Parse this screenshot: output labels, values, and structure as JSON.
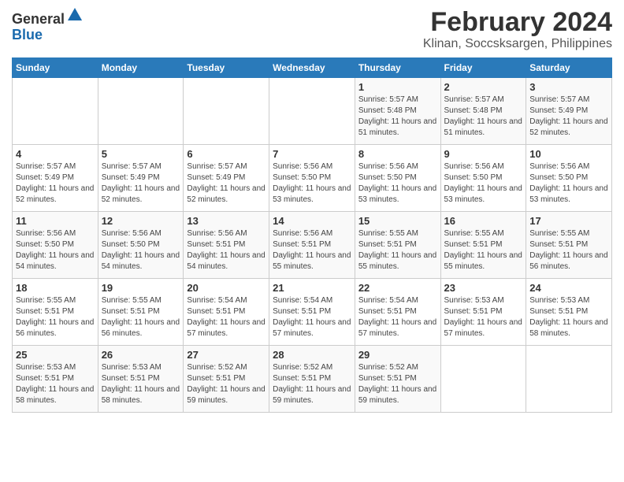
{
  "header": {
    "logo_general": "General",
    "logo_blue": "Blue",
    "month_title": "February 2024",
    "location": "Klinan, Soccsksargen, Philippines"
  },
  "days_of_week": [
    "Sunday",
    "Monday",
    "Tuesday",
    "Wednesday",
    "Thursday",
    "Friday",
    "Saturday"
  ],
  "weeks": [
    [
      {
        "day": "",
        "sunrise": "",
        "sunset": "",
        "daylight": "",
        "empty": true
      },
      {
        "day": "",
        "sunrise": "",
        "sunset": "",
        "daylight": "",
        "empty": true
      },
      {
        "day": "",
        "sunrise": "",
        "sunset": "",
        "daylight": "",
        "empty": true
      },
      {
        "day": "",
        "sunrise": "",
        "sunset": "",
        "daylight": "",
        "empty": true
      },
      {
        "day": "1",
        "sunrise": "5:57 AM",
        "sunset": "5:48 PM",
        "daylight": "11 hours and 51 minutes."
      },
      {
        "day": "2",
        "sunrise": "5:57 AM",
        "sunset": "5:48 PM",
        "daylight": "11 hours and 51 minutes."
      },
      {
        "day": "3",
        "sunrise": "5:57 AM",
        "sunset": "5:49 PM",
        "daylight": "11 hours and 52 minutes."
      }
    ],
    [
      {
        "day": "4",
        "sunrise": "5:57 AM",
        "sunset": "5:49 PM",
        "daylight": "11 hours and 52 minutes."
      },
      {
        "day": "5",
        "sunrise": "5:57 AM",
        "sunset": "5:49 PM",
        "daylight": "11 hours and 52 minutes."
      },
      {
        "day": "6",
        "sunrise": "5:57 AM",
        "sunset": "5:49 PM",
        "daylight": "11 hours and 52 minutes."
      },
      {
        "day": "7",
        "sunrise": "5:56 AM",
        "sunset": "5:50 PM",
        "daylight": "11 hours and 53 minutes."
      },
      {
        "day": "8",
        "sunrise": "5:56 AM",
        "sunset": "5:50 PM",
        "daylight": "11 hours and 53 minutes."
      },
      {
        "day": "9",
        "sunrise": "5:56 AM",
        "sunset": "5:50 PM",
        "daylight": "11 hours and 53 minutes."
      },
      {
        "day": "10",
        "sunrise": "5:56 AM",
        "sunset": "5:50 PM",
        "daylight": "11 hours and 53 minutes."
      }
    ],
    [
      {
        "day": "11",
        "sunrise": "5:56 AM",
        "sunset": "5:50 PM",
        "daylight": "11 hours and 54 minutes."
      },
      {
        "day": "12",
        "sunrise": "5:56 AM",
        "sunset": "5:50 PM",
        "daylight": "11 hours and 54 minutes."
      },
      {
        "day": "13",
        "sunrise": "5:56 AM",
        "sunset": "5:51 PM",
        "daylight": "11 hours and 54 minutes."
      },
      {
        "day": "14",
        "sunrise": "5:56 AM",
        "sunset": "5:51 PM",
        "daylight": "11 hours and 55 minutes."
      },
      {
        "day": "15",
        "sunrise": "5:55 AM",
        "sunset": "5:51 PM",
        "daylight": "11 hours and 55 minutes."
      },
      {
        "day": "16",
        "sunrise": "5:55 AM",
        "sunset": "5:51 PM",
        "daylight": "11 hours and 55 minutes."
      },
      {
        "day": "17",
        "sunrise": "5:55 AM",
        "sunset": "5:51 PM",
        "daylight": "11 hours and 56 minutes."
      }
    ],
    [
      {
        "day": "18",
        "sunrise": "5:55 AM",
        "sunset": "5:51 PM",
        "daylight": "11 hours and 56 minutes."
      },
      {
        "day": "19",
        "sunrise": "5:55 AM",
        "sunset": "5:51 PM",
        "daylight": "11 hours and 56 minutes."
      },
      {
        "day": "20",
        "sunrise": "5:54 AM",
        "sunset": "5:51 PM",
        "daylight": "11 hours and 57 minutes."
      },
      {
        "day": "21",
        "sunrise": "5:54 AM",
        "sunset": "5:51 PM",
        "daylight": "11 hours and 57 minutes."
      },
      {
        "day": "22",
        "sunrise": "5:54 AM",
        "sunset": "5:51 PM",
        "daylight": "11 hours and 57 minutes."
      },
      {
        "day": "23",
        "sunrise": "5:53 AM",
        "sunset": "5:51 PM",
        "daylight": "11 hours and 57 minutes."
      },
      {
        "day": "24",
        "sunrise": "5:53 AM",
        "sunset": "5:51 PM",
        "daylight": "11 hours and 58 minutes."
      }
    ],
    [
      {
        "day": "25",
        "sunrise": "5:53 AM",
        "sunset": "5:51 PM",
        "daylight": "11 hours and 58 minutes."
      },
      {
        "day": "26",
        "sunrise": "5:53 AM",
        "sunset": "5:51 PM",
        "daylight": "11 hours and 58 minutes."
      },
      {
        "day": "27",
        "sunrise": "5:52 AM",
        "sunset": "5:51 PM",
        "daylight": "11 hours and 59 minutes."
      },
      {
        "day": "28",
        "sunrise": "5:52 AM",
        "sunset": "5:51 PM",
        "daylight": "11 hours and 59 minutes."
      },
      {
        "day": "29",
        "sunrise": "5:52 AM",
        "sunset": "5:51 PM",
        "daylight": "11 hours and 59 minutes."
      },
      {
        "day": "",
        "sunrise": "",
        "sunset": "",
        "daylight": "",
        "empty": true
      },
      {
        "day": "",
        "sunrise": "",
        "sunset": "",
        "daylight": "",
        "empty": true
      }
    ]
  ],
  "labels": {
    "sunrise_prefix": "Sunrise: ",
    "sunset_prefix": "Sunset: ",
    "daylight_prefix": "Daylight: "
  }
}
